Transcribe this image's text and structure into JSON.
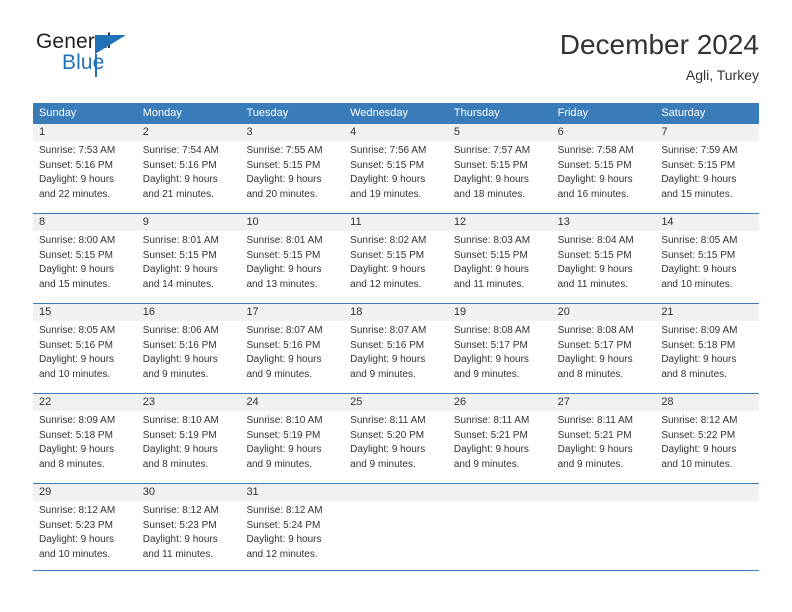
{
  "brand": {
    "name_top": "General",
    "name_bottom": "Blue",
    "accent_color": "#1f71b8",
    "logo_icon": "triangle-icon"
  },
  "header": {
    "title": "December 2024",
    "subtitle": "Agli, Turkey"
  },
  "calendar": {
    "header_bg": "#3a7cba",
    "header_text_color": "#ffffff",
    "daynum_bg": "#f1f1f1",
    "weekday_headers": [
      "Sunday",
      "Monday",
      "Tuesday",
      "Wednesday",
      "Thursday",
      "Friday",
      "Saturday"
    ],
    "weeks": [
      [
        {
          "day": "1",
          "sunrise": "Sunrise: 7:53 AM",
          "sunset": "Sunset: 5:16 PM",
          "daylight_line1": "Daylight: 9 hours",
          "daylight_line2": "and 22 minutes."
        },
        {
          "day": "2",
          "sunrise": "Sunrise: 7:54 AM",
          "sunset": "Sunset: 5:16 PM",
          "daylight_line1": "Daylight: 9 hours",
          "daylight_line2": "and 21 minutes."
        },
        {
          "day": "3",
          "sunrise": "Sunrise: 7:55 AM",
          "sunset": "Sunset: 5:15 PM",
          "daylight_line1": "Daylight: 9 hours",
          "daylight_line2": "and 20 minutes."
        },
        {
          "day": "4",
          "sunrise": "Sunrise: 7:56 AM",
          "sunset": "Sunset: 5:15 PM",
          "daylight_line1": "Daylight: 9 hours",
          "daylight_line2": "and 19 minutes."
        },
        {
          "day": "5",
          "sunrise": "Sunrise: 7:57 AM",
          "sunset": "Sunset: 5:15 PM",
          "daylight_line1": "Daylight: 9 hours",
          "daylight_line2": "and 18 minutes."
        },
        {
          "day": "6",
          "sunrise": "Sunrise: 7:58 AM",
          "sunset": "Sunset: 5:15 PM",
          "daylight_line1": "Daylight: 9 hours",
          "daylight_line2": "and 16 minutes."
        },
        {
          "day": "7",
          "sunrise": "Sunrise: 7:59 AM",
          "sunset": "Sunset: 5:15 PM",
          "daylight_line1": "Daylight: 9 hours",
          "daylight_line2": "and 15 minutes."
        }
      ],
      [
        {
          "day": "8",
          "sunrise": "Sunrise: 8:00 AM",
          "sunset": "Sunset: 5:15 PM",
          "daylight_line1": "Daylight: 9 hours",
          "daylight_line2": "and 15 minutes."
        },
        {
          "day": "9",
          "sunrise": "Sunrise: 8:01 AM",
          "sunset": "Sunset: 5:15 PM",
          "daylight_line1": "Daylight: 9 hours",
          "daylight_line2": "and 14 minutes."
        },
        {
          "day": "10",
          "sunrise": "Sunrise: 8:01 AM",
          "sunset": "Sunset: 5:15 PM",
          "daylight_line1": "Daylight: 9 hours",
          "daylight_line2": "and 13 minutes."
        },
        {
          "day": "11",
          "sunrise": "Sunrise: 8:02 AM",
          "sunset": "Sunset: 5:15 PM",
          "daylight_line1": "Daylight: 9 hours",
          "daylight_line2": "and 12 minutes."
        },
        {
          "day": "12",
          "sunrise": "Sunrise: 8:03 AM",
          "sunset": "Sunset: 5:15 PM",
          "daylight_line1": "Daylight: 9 hours",
          "daylight_line2": "and 11 minutes."
        },
        {
          "day": "13",
          "sunrise": "Sunrise: 8:04 AM",
          "sunset": "Sunset: 5:15 PM",
          "daylight_line1": "Daylight: 9 hours",
          "daylight_line2": "and 11 minutes."
        },
        {
          "day": "14",
          "sunrise": "Sunrise: 8:05 AM",
          "sunset": "Sunset: 5:15 PM",
          "daylight_line1": "Daylight: 9 hours",
          "daylight_line2": "and 10 minutes."
        }
      ],
      [
        {
          "day": "15",
          "sunrise": "Sunrise: 8:05 AM",
          "sunset": "Sunset: 5:16 PM",
          "daylight_line1": "Daylight: 9 hours",
          "daylight_line2": "and 10 minutes."
        },
        {
          "day": "16",
          "sunrise": "Sunrise: 8:06 AM",
          "sunset": "Sunset: 5:16 PM",
          "daylight_line1": "Daylight: 9 hours",
          "daylight_line2": "and 9 minutes."
        },
        {
          "day": "17",
          "sunrise": "Sunrise: 8:07 AM",
          "sunset": "Sunset: 5:16 PM",
          "daylight_line1": "Daylight: 9 hours",
          "daylight_line2": "and 9 minutes."
        },
        {
          "day": "18",
          "sunrise": "Sunrise: 8:07 AM",
          "sunset": "Sunset: 5:16 PM",
          "daylight_line1": "Daylight: 9 hours",
          "daylight_line2": "and 9 minutes."
        },
        {
          "day": "19",
          "sunrise": "Sunrise: 8:08 AM",
          "sunset": "Sunset: 5:17 PM",
          "daylight_line1": "Daylight: 9 hours",
          "daylight_line2": "and 9 minutes."
        },
        {
          "day": "20",
          "sunrise": "Sunrise: 8:08 AM",
          "sunset": "Sunset: 5:17 PM",
          "daylight_line1": "Daylight: 9 hours",
          "daylight_line2": "and 8 minutes."
        },
        {
          "day": "21",
          "sunrise": "Sunrise: 8:09 AM",
          "sunset": "Sunset: 5:18 PM",
          "daylight_line1": "Daylight: 9 hours",
          "daylight_line2": "and 8 minutes."
        }
      ],
      [
        {
          "day": "22",
          "sunrise": "Sunrise: 8:09 AM",
          "sunset": "Sunset: 5:18 PM",
          "daylight_line1": "Daylight: 9 hours",
          "daylight_line2": "and 8 minutes."
        },
        {
          "day": "23",
          "sunrise": "Sunrise: 8:10 AM",
          "sunset": "Sunset: 5:19 PM",
          "daylight_line1": "Daylight: 9 hours",
          "daylight_line2": "and 8 minutes."
        },
        {
          "day": "24",
          "sunrise": "Sunrise: 8:10 AM",
          "sunset": "Sunset: 5:19 PM",
          "daylight_line1": "Daylight: 9 hours",
          "daylight_line2": "and 9 minutes."
        },
        {
          "day": "25",
          "sunrise": "Sunrise: 8:11 AM",
          "sunset": "Sunset: 5:20 PM",
          "daylight_line1": "Daylight: 9 hours",
          "daylight_line2": "and 9 minutes."
        },
        {
          "day": "26",
          "sunrise": "Sunrise: 8:11 AM",
          "sunset": "Sunset: 5:21 PM",
          "daylight_line1": "Daylight: 9 hours",
          "daylight_line2": "and 9 minutes."
        },
        {
          "day": "27",
          "sunrise": "Sunrise: 8:11 AM",
          "sunset": "Sunset: 5:21 PM",
          "daylight_line1": "Daylight: 9 hours",
          "daylight_line2": "and 9 minutes."
        },
        {
          "day": "28",
          "sunrise": "Sunrise: 8:12 AM",
          "sunset": "Sunset: 5:22 PM",
          "daylight_line1": "Daylight: 9 hours",
          "daylight_line2": "and 10 minutes."
        }
      ],
      [
        {
          "day": "29",
          "sunrise": "Sunrise: 8:12 AM",
          "sunset": "Sunset: 5:23 PM",
          "daylight_line1": "Daylight: 9 hours",
          "daylight_line2": "and 10 minutes."
        },
        {
          "day": "30",
          "sunrise": "Sunrise: 8:12 AM",
          "sunset": "Sunset: 5:23 PM",
          "daylight_line1": "Daylight: 9 hours",
          "daylight_line2": "and 11 minutes."
        },
        {
          "day": "31",
          "sunrise": "Sunrise: 8:12 AM",
          "sunset": "Sunset: 5:24 PM",
          "daylight_line1": "Daylight: 9 hours",
          "daylight_line2": "and 12 minutes."
        },
        {
          "day": "",
          "sunrise": "",
          "sunset": "",
          "daylight_line1": "",
          "daylight_line2": ""
        },
        {
          "day": "",
          "sunrise": "",
          "sunset": "",
          "daylight_line1": "",
          "daylight_line2": ""
        },
        {
          "day": "",
          "sunrise": "",
          "sunset": "",
          "daylight_line1": "",
          "daylight_line2": ""
        },
        {
          "day": "",
          "sunrise": "",
          "sunset": "",
          "daylight_line1": "",
          "daylight_line2": ""
        }
      ]
    ]
  }
}
